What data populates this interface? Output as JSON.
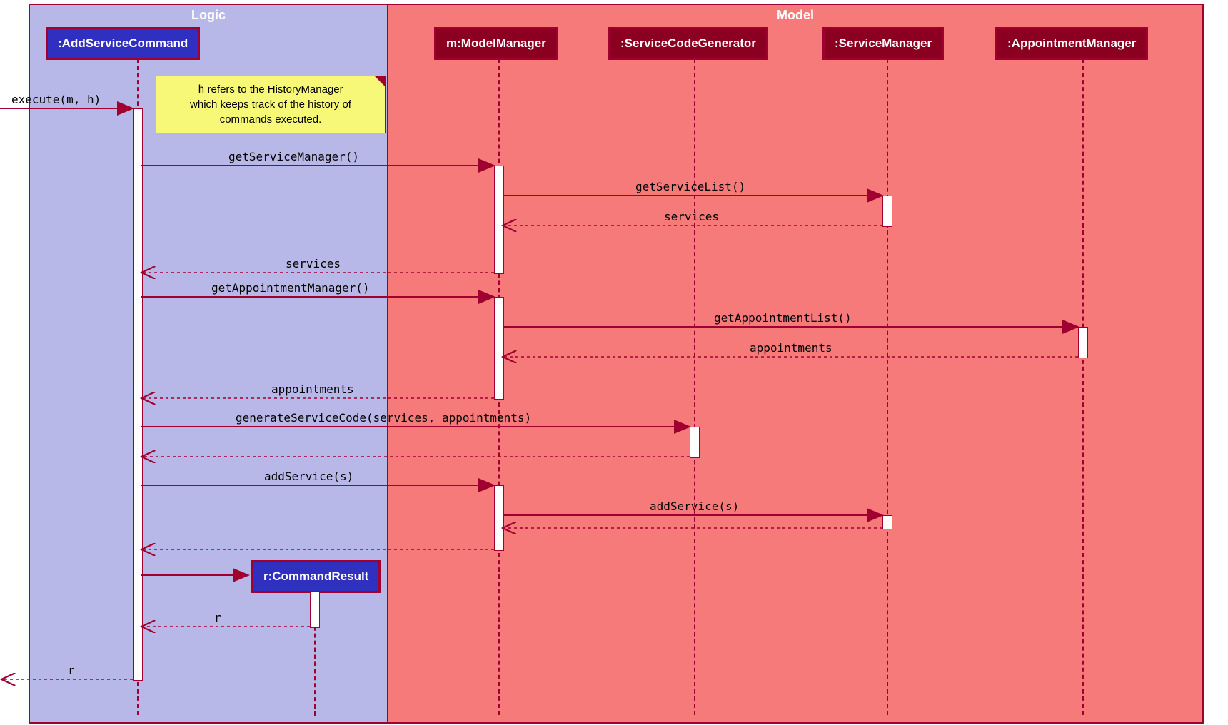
{
  "type": "sequence-diagram",
  "boxes": {
    "logic": {
      "title": "Logic"
    },
    "model": {
      "title": "Model"
    }
  },
  "participants": {
    "addServiceCommand": ":AddServiceCommand",
    "modelManager": "m:ModelManager",
    "serviceCodeGenerator": ":ServiceCodeGenerator",
    "serviceManager": ":ServiceManager",
    "appointmentManager": ":AppointmentManager",
    "commandResult": "r:CommandResult"
  },
  "note": {
    "line1": "h refers to the HistoryManager",
    "line2": "which keeps track of the history of",
    "line3": "commands executed."
  },
  "messages": {
    "execute": "execute(m, h)",
    "getServiceManager": "getServiceManager()",
    "getServiceList": "getServiceList()",
    "retServices1": "services",
    "retServices2": "services",
    "getAppointmentManager": "getAppointmentManager()",
    "getAppointmentList": "getAppointmentList()",
    "retAppointments1": "appointments",
    "retAppointments2": "appointments",
    "generateServiceCode": "generateServiceCode(services, appointments)",
    "addService1": "addService(s)",
    "addService2": "addService(s)",
    "retR1": "r",
    "retR2": "r"
  }
}
